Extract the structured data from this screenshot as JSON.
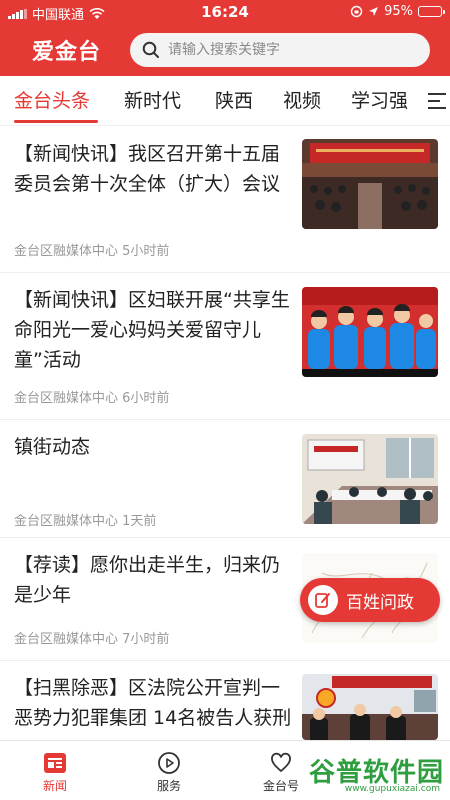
{
  "status_bar": {
    "carrier": "中国联通",
    "time": "16:24",
    "battery": "95%",
    "battery_level": 0.95
  },
  "header": {
    "logo": "爱金台",
    "search_placeholder": "请输入搜索关键字"
  },
  "tabs": [
    {
      "label": "金台头条",
      "active": true
    },
    {
      "label": "新时代"
    },
    {
      "label": "陕西"
    },
    {
      "label": "视频"
    },
    {
      "label": "学习强"
    }
  ],
  "news": [
    {
      "title": "【新闻快讯】我区召开第十五届委员会第十次全体（扩大）会议",
      "source": "金台区融媒体中心",
      "time": "5小时前"
    },
    {
      "title": "【新闻快讯】区妇联开展“共享生命阳光一爱心妈妈关爱留守儿童”活动",
      "source": "金台区融媒体中心",
      "time": "6小时前"
    },
    {
      "title": "镇街动态",
      "source": "金台区融媒体中心",
      "time": "1天前"
    },
    {
      "title": "【荐读】愿你出走半生，归来仍是少年",
      "source": "金台区融媒体中心",
      "time": "7小时前"
    },
    {
      "title": "【扫黑除恶】区法院公开宣判一恶势力犯罪集团 14名被告人获刑",
      "source": "",
      "time": ""
    }
  ],
  "floating_button": {
    "label": "百姓问政"
  },
  "bottom_nav": [
    {
      "label": "新闻",
      "active": true
    },
    {
      "label": "服务"
    },
    {
      "label": "金台号"
    }
  ],
  "watermark": {
    "text": "谷普软件园",
    "url": "www.gupuxiazai.com"
  },
  "colors": {
    "brand": "#e53935",
    "watermark": "#2e9e3f"
  }
}
